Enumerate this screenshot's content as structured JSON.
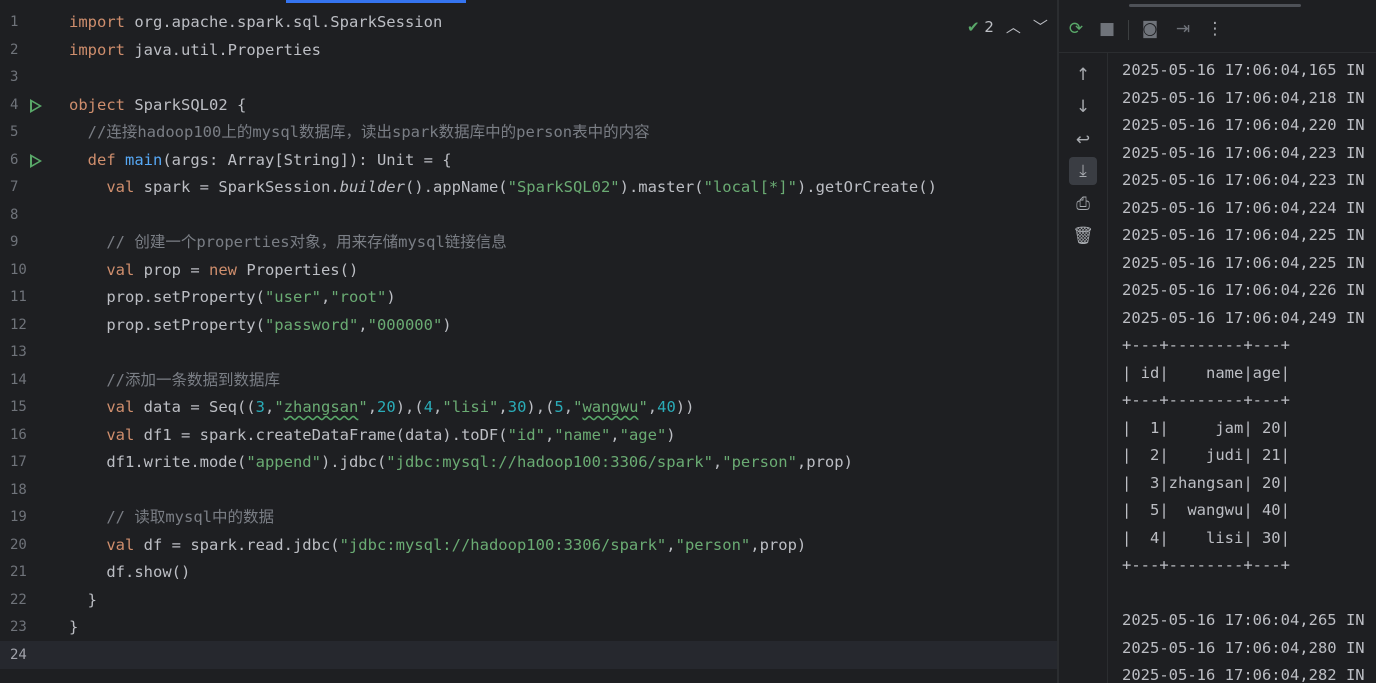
{
  "editor": {
    "line_numbers": [
      "1",
      "2",
      "3",
      "4",
      "5",
      "6",
      "7",
      "8",
      "9",
      "10",
      "11",
      "12",
      "13",
      "14",
      "15",
      "16",
      "17",
      "18",
      "19",
      "20",
      "21",
      "22",
      "23",
      "24"
    ],
    "inspection_count": "2",
    "lines": [
      [
        {
          "t": "import",
          "c": "kw"
        },
        {
          "t": " org.apache.spark.sql.SparkSession"
        }
      ],
      [
        {
          "t": "import",
          "c": "kw"
        },
        {
          "t": " java.util.Properties"
        }
      ],
      [],
      [
        {
          "t": "object",
          "c": "kw"
        },
        {
          "t": " SparkSQL02 {"
        }
      ],
      [
        {
          "t": "  "
        },
        {
          "t": "//连接hadoop100上的mysql数据库，读出spark数据库中的person表中的内容",
          "c": "cm"
        }
      ],
      [
        {
          "t": "  "
        },
        {
          "t": "def",
          "c": "kw"
        },
        {
          "t": " "
        },
        {
          "t": "main",
          "c": "fn"
        },
        {
          "t": "(args: Array[String]): Unit = {"
        }
      ],
      [
        {
          "t": "    "
        },
        {
          "t": "val",
          "c": "kw"
        },
        {
          "t": " spark = SparkSession."
        },
        {
          "t": "builder",
          "c": "it"
        },
        {
          "t": "().appName("
        },
        {
          "t": "\"SparkSQL02\"",
          "c": "str"
        },
        {
          "t": ").master("
        },
        {
          "t": "\"local[*]\"",
          "c": "str"
        },
        {
          "t": ").getOrCreate()"
        }
      ],
      [],
      [
        {
          "t": "    "
        },
        {
          "t": "// 创建一个properties对象，用来存储mysql链接信息",
          "c": "cm"
        }
      ],
      [
        {
          "t": "    "
        },
        {
          "t": "val",
          "c": "kw"
        },
        {
          "t": " prop = "
        },
        {
          "t": "new",
          "c": "kw"
        },
        {
          "t": " Properties()"
        }
      ],
      [
        {
          "t": "    prop.setProperty("
        },
        {
          "t": "\"user\"",
          "c": "str"
        },
        {
          "t": ","
        },
        {
          "t": "\"root\"",
          "c": "str"
        },
        {
          "t": ")"
        }
      ],
      [
        {
          "t": "    prop.setProperty("
        },
        {
          "t": "\"password\"",
          "c": "str"
        },
        {
          "t": ","
        },
        {
          "t": "\"000000\"",
          "c": "str"
        },
        {
          "t": ")"
        }
      ],
      [],
      [
        {
          "t": "    "
        },
        {
          "t": "//添加一条数据到数据库",
          "c": "cm"
        }
      ],
      [
        {
          "t": "    "
        },
        {
          "t": "val",
          "c": "kw"
        },
        {
          "t": " data = Seq(("
        },
        {
          "t": "3",
          "c": "num"
        },
        {
          "t": ","
        },
        {
          "t": "\"",
          "c": "str"
        },
        {
          "t": "zhangsan",
          "c": "str sq"
        },
        {
          "t": "\"",
          "c": "str"
        },
        {
          "t": ","
        },
        {
          "t": "20",
          "c": "num"
        },
        {
          "t": "),("
        },
        {
          "t": "4",
          "c": "num"
        },
        {
          "t": ","
        },
        {
          "t": "\"lisi\"",
          "c": "str"
        },
        {
          "t": ","
        },
        {
          "t": "30",
          "c": "num"
        },
        {
          "t": "),("
        },
        {
          "t": "5",
          "c": "num"
        },
        {
          "t": ","
        },
        {
          "t": "\"",
          "c": "str"
        },
        {
          "t": "wangwu",
          "c": "str sq"
        },
        {
          "t": "\"",
          "c": "str"
        },
        {
          "t": ","
        },
        {
          "t": "40",
          "c": "num"
        },
        {
          "t": "))"
        }
      ],
      [
        {
          "t": "    "
        },
        {
          "t": "val",
          "c": "kw"
        },
        {
          "t": " df1 = spark.createDataFrame(data).toDF("
        },
        {
          "t": "\"id\"",
          "c": "str"
        },
        {
          "t": ","
        },
        {
          "t": "\"name\"",
          "c": "str"
        },
        {
          "t": ","
        },
        {
          "t": "\"age\"",
          "c": "str"
        },
        {
          "t": ")"
        }
      ],
      [
        {
          "t": "    df1.write.mode("
        },
        {
          "t": "\"append\"",
          "c": "str"
        },
        {
          "t": ").jdbc("
        },
        {
          "t": "\"jdbc:mysql://hadoop100:3306/spark\"",
          "c": "str"
        },
        {
          "t": ","
        },
        {
          "t": "\"person\"",
          "c": "str"
        },
        {
          "t": ",prop)"
        }
      ],
      [],
      [
        {
          "t": "    "
        },
        {
          "t": "// 读取mysql中的数据",
          "c": "cm"
        }
      ],
      [
        {
          "t": "    "
        },
        {
          "t": "val",
          "c": "kw"
        },
        {
          "t": " df = spark.read.jdbc("
        },
        {
          "t": "\"jdbc:mysql://hadoop100:3306/spark\"",
          "c": "str"
        },
        {
          "t": ","
        },
        {
          "t": "\"person\"",
          "c": "str"
        },
        {
          "t": ",prop)"
        }
      ],
      [
        {
          "t": "    df.show()"
        }
      ],
      [
        {
          "t": "  }"
        }
      ],
      [
        {
          "t": "}"
        }
      ],
      []
    ]
  },
  "console": {
    "output": [
      "2025-05-16 17:06:04,165 IN",
      "2025-05-16 17:06:04,218 IN",
      "2025-05-16 17:06:04,220 IN",
      "2025-05-16 17:06:04,223 IN",
      "2025-05-16 17:06:04,223 IN",
      "2025-05-16 17:06:04,224 IN",
      "2025-05-16 17:06:04,225 IN",
      "2025-05-16 17:06:04,225 IN",
      "2025-05-16 17:06:04,226 IN",
      "2025-05-16 17:06:04,249 IN",
      "+---+--------+---+",
      "| id|    name|age|",
      "+---+--------+---+",
      "|  1|     jam| 20|",
      "|  2|    judi| 21|",
      "|  3|zhangsan| 20|",
      "|  5|  wangwu| 40|",
      "|  4|    lisi| 30|",
      "+---+--------+---+",
      "",
      "2025-05-16 17:06:04,265 IN",
      "2025-05-16 17:06:04,280 IN",
      "2025-05-16 17:06:04,282 IN"
    ]
  }
}
